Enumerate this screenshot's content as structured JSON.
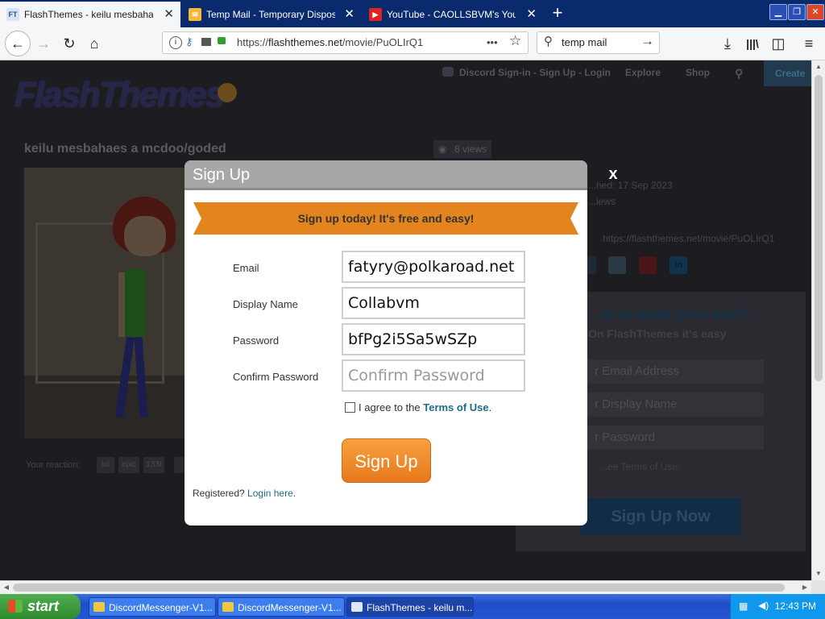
{
  "browser": {
    "tabs": [
      {
        "title": "FlashThemes - keilu mesbahaes a",
        "icon": "flashthemes-favicon",
        "active": true
      },
      {
        "title": "Temp Mail - Temporary Disposable",
        "icon": "tempmail-favicon",
        "active": false
      },
      {
        "title": "YouTube - CAOLLSBVM's YouTube",
        "icon": "youtube-favicon",
        "active": false
      }
    ],
    "url_prefix": "https://",
    "url_host": "flashthemes.net",
    "url_path": "/movie/PuOLIrQ1",
    "search_value": "temp mail",
    "more_label": "•••"
  },
  "site": {
    "logo_text": "FlashThemes",
    "nav": {
      "discord": "Discord Sign-in - Sign Up - Login",
      "explore": "Explore",
      "shop": "Shop",
      "create": "Create"
    },
    "movie_title": "keilu mesbahaes a mcdoo/goded",
    "views": "8 views",
    "published": "...hed: 17 Sep 2023",
    "views_side": "...iews",
    "movie_url": "https://flashthemes.net/movie/PuOLIrQ1",
    "reaction_label": "Your reaction:",
    "reactions": [
      "lol",
      "epic",
      "133t"
    ],
    "promo": {
      "heading": "...nt to make your own?",
      "sub": "On FlashThemes it's easy",
      "email_ph": "r Email Address",
      "name_ph": "r Display Name",
      "pass_ph": "r Password",
      "agree": "...ee  Terms of Use.",
      "button": "Sign Up Now"
    }
  },
  "modal": {
    "title": "Sign Up",
    "close": "x",
    "ribbon": "Sign up today! It's free and easy!",
    "email_label": "Email",
    "email_value": "fatyry@polkaroad.net",
    "name_label": "Display Name",
    "name_value": "Collabvm",
    "password_label": "Password",
    "password_value": "bfPg2i5Sa5wSZp",
    "confirm_label": "Confirm Password",
    "confirm_placeholder": "Confirm Password",
    "agree_prefix": "I agree to the ",
    "agree_link": "Terms of Use",
    "agree_suffix": ".",
    "submit": "Sign Up",
    "registered": "Registered? ",
    "login_link": "Login here",
    "login_suffix": "."
  },
  "taskbar": {
    "start": "start",
    "tasks": [
      "DiscordMessenger-V1...",
      "DiscordMessenger-V1...",
      "FlashThemes - keilu m..."
    ],
    "clock": "12:43 PM"
  },
  "colors": {
    "accent_orange": "#e3841e",
    "link_blue": "#1d6c8a",
    "tab_bar": "#0a2a6e"
  }
}
